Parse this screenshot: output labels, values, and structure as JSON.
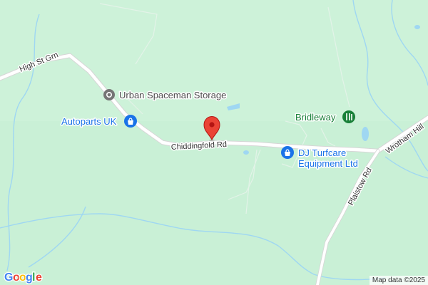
{
  "roads": {
    "high_st_grn": "High St Grn",
    "chiddingfold_rd": "Chiddingfold Rd",
    "plaistow_rd": "Plaistow Rd",
    "wrotham_hill": "Wrotham Hill"
  },
  "places": {
    "urban_spaceman": "Urban Spaceman Storage",
    "autoparts": "Autoparts UK",
    "bridleway": "Bridleway",
    "dj_turfcare_line1": "DJ Turfcare",
    "dj_turfcare_line2": "Equipment Ltd"
  },
  "branding": {
    "logo_g": "G",
    "logo_o1": "o",
    "logo_o2": "o",
    "logo_g2": "g",
    "logo_l": "l",
    "logo_e": "e"
  },
  "attribution": "Map data ©2025",
  "colors": {
    "land": "#c9f0d6",
    "road": "#ffffff",
    "water": "#9fd7f2",
    "pin": "#ea4335",
    "shop_poi": "#1a73e8",
    "storage_poi": "#757575",
    "park_poi": "#188038"
  },
  "icons": {
    "pin": "map-pin-icon",
    "shop": "shopping-bag-icon",
    "storage": "storage-icon",
    "park": "hiking-icon"
  }
}
